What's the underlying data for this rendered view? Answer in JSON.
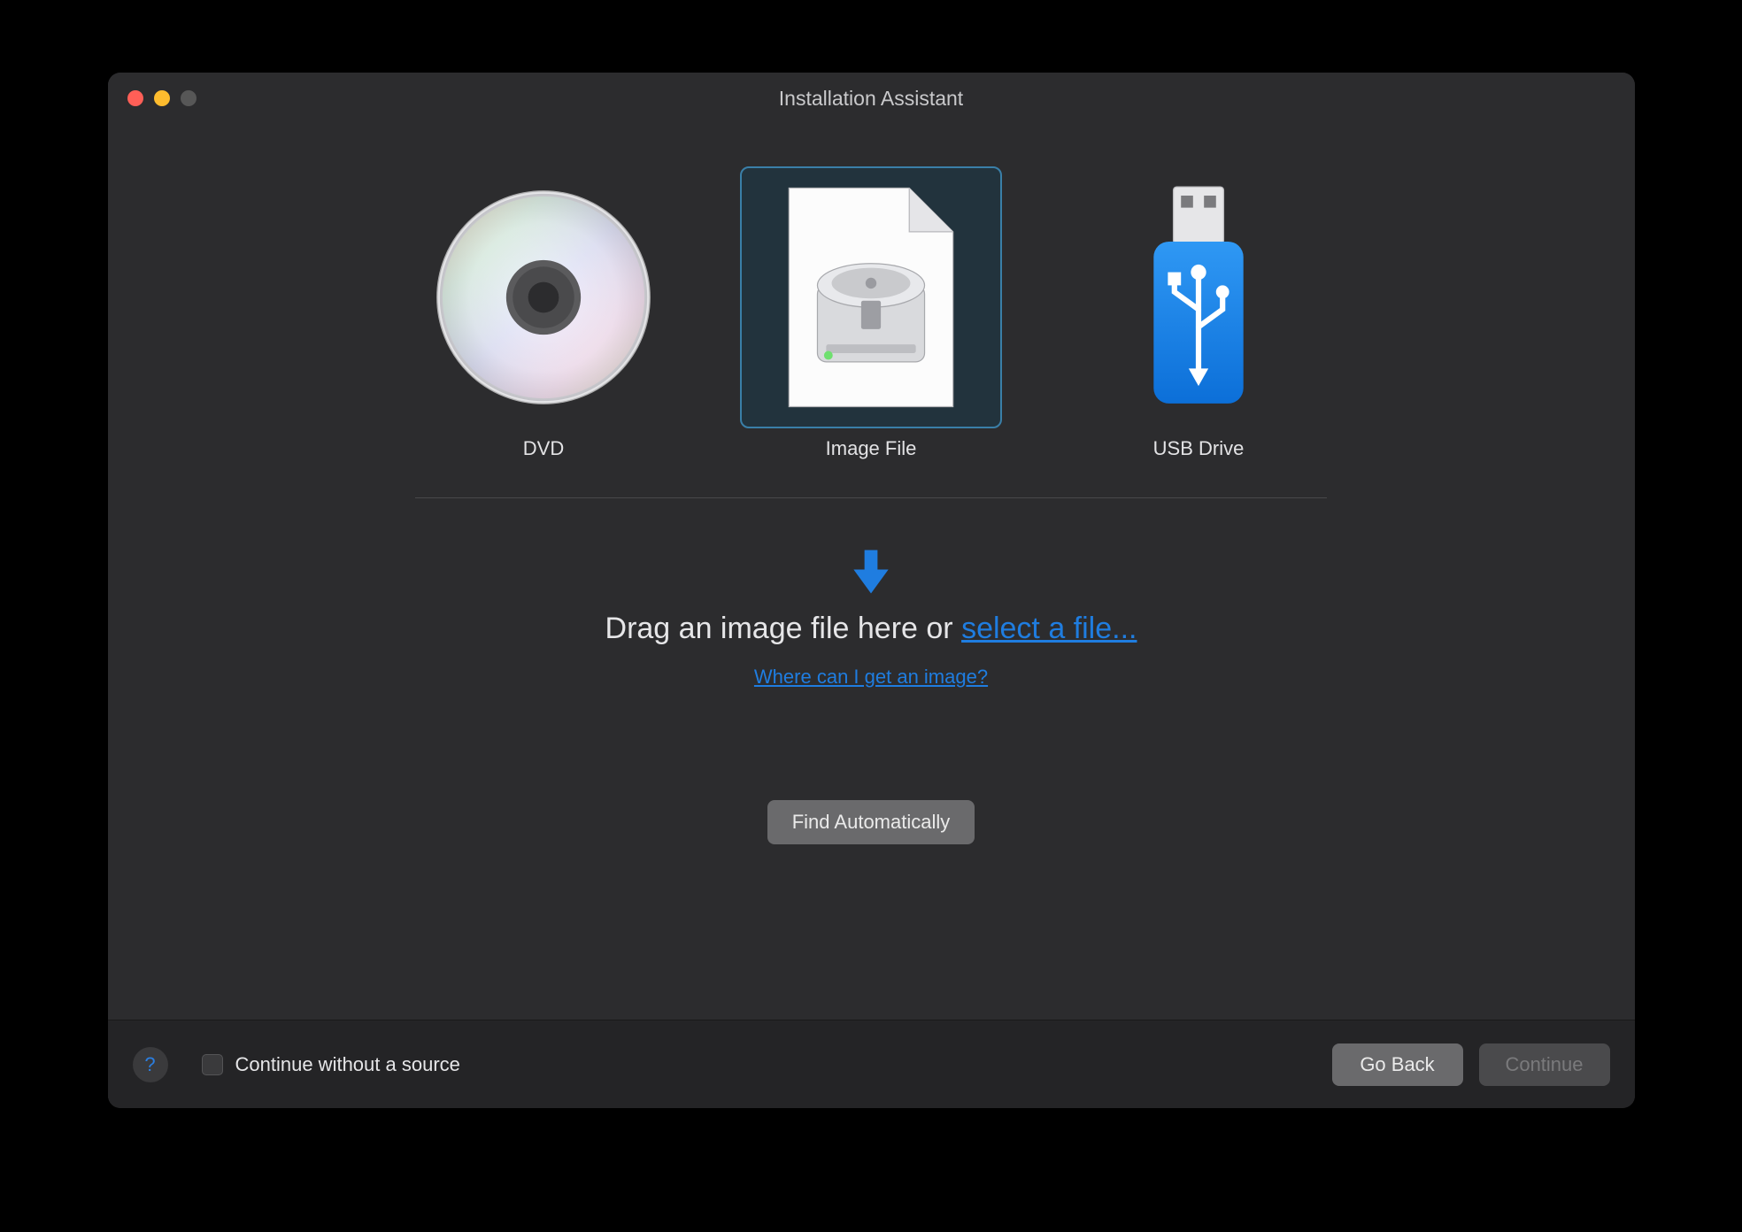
{
  "window": {
    "title": "Installation Assistant"
  },
  "options": {
    "dvd": {
      "label": "DVD"
    },
    "image_file": {
      "label": "Image File",
      "selected": true
    },
    "usb_drive": {
      "label": "USB Drive"
    }
  },
  "drop": {
    "prefix": "Drag an image file here or ",
    "select_link": "select a file...",
    "help_link": "Where can I get an image?"
  },
  "buttons": {
    "find_auto": "Find Automatically",
    "go_back": "Go Back",
    "continue": "Continue"
  },
  "footer": {
    "checkbox_label": "Continue without a source",
    "help_symbol": "?"
  },
  "colors": {
    "accent": "#1f7de0",
    "window_bg": "#2c2c2e",
    "footer_bg": "#242426"
  }
}
